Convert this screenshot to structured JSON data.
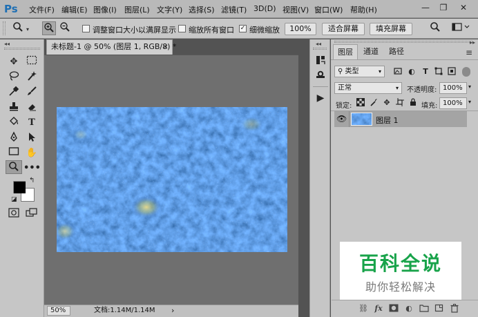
{
  "app": {
    "logo": "Ps",
    "menu": [
      "文件(F)",
      "编辑(E)",
      "图像(I)",
      "图层(L)",
      "文字(Y)",
      "选择(S)",
      "滤镜(T)",
      "3D(D)",
      "视图(V)",
      "窗口(W)",
      "帮助(H)"
    ],
    "window_controls": {
      "minimize": "—",
      "restore": "❐",
      "close": "✕"
    }
  },
  "options_bar": {
    "tool_icon": "zoom-tool-icon",
    "zoom_in_icon": "zoom-in-icon",
    "zoom_out_icon": "zoom-out-icon",
    "resize_windows": {
      "label": "调整窗口大小以满屏显示",
      "checked": false
    },
    "zoom_all_windows": {
      "label": "缩放所有窗口",
      "checked": false
    },
    "scrubby_zoom": {
      "label": "细微缩放",
      "checked": true
    },
    "percent_button": "100%",
    "fit_screen_button": "适合屏幕",
    "fill_screen_button": "填充屏幕"
  },
  "document": {
    "tab_title": "未标题-1 @ 50% (图层 1, RGB/8) *",
    "tab_close": "×",
    "status_zoom": "50%",
    "status_doc": "文档:1.14M/1.14M",
    "status_arrow": "›"
  },
  "layers_panel": {
    "tabs": [
      "图层",
      "通道",
      "路径"
    ],
    "active_tab": 0,
    "filter_kind": "类型",
    "blend_mode": "正常",
    "opacity_label": "不透明度:",
    "opacity_value": "100%",
    "lock_label": "锁定:",
    "fill_label": "填充:",
    "fill_value": "100%",
    "layers": [
      {
        "name": "图层 1",
        "visible": true,
        "selected": true
      }
    ]
  },
  "watermark": {
    "title": "百科全说",
    "subtitle": "助你轻松解决"
  },
  "colors": {
    "accent": "#1e6fb4",
    "watermark_green": "#18a34a",
    "foreground_swatch": "#000000",
    "background_swatch": "#ffffff",
    "image_blue": "#1f4fb8"
  }
}
